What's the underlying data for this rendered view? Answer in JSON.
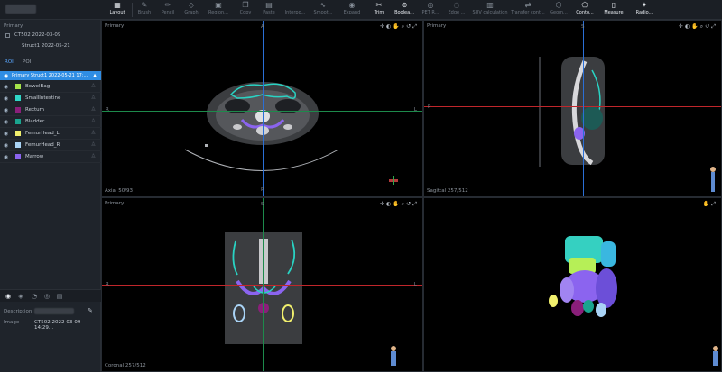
{
  "toolbar": {
    "items": [
      {
        "label": "Layout",
        "icon": "layout-icon"
      },
      {
        "label": "Brush",
        "icon": "brush-icon"
      },
      {
        "label": "Pencil",
        "icon": "pencil-icon"
      },
      {
        "label": "Graph",
        "icon": "graph-icon"
      },
      {
        "label": "Region...",
        "icon": "region-icon"
      },
      {
        "label": "Copy",
        "icon": "copy-icon"
      },
      {
        "label": "Paste",
        "icon": "paste-icon"
      },
      {
        "label": "Interpo...",
        "icon": "interpolate-icon"
      },
      {
        "label": "Smoot...",
        "icon": "smooth-icon"
      },
      {
        "label": "Expand",
        "icon": "expand-icon"
      },
      {
        "label": "Trim",
        "icon": "trim-icon"
      },
      {
        "label": "Boolea...",
        "icon": "boolean-icon"
      },
      {
        "label": "PET R...",
        "icon": "pet-icon"
      },
      {
        "label": "Edge ...",
        "icon": "edge-icon"
      },
      {
        "label": "SUV calculation",
        "icon": "suv-icon"
      },
      {
        "label": "Transfer cont...",
        "icon": "transfer-icon"
      },
      {
        "label": "Geom...",
        "icon": "geometry-icon"
      },
      {
        "label": "Conto...",
        "icon": "contour-icon"
      },
      {
        "label": "Measure",
        "icon": "measure-icon"
      },
      {
        "label": "Radio...",
        "icon": "radiomics-icon"
      }
    ]
  },
  "left": {
    "primary_label": "Primary",
    "tree": [
      {
        "label": "CT502  2022-03-09"
      },
      {
        "label": "Struct1  2022-05-21"
      }
    ],
    "tabs": [
      "ROI",
      "POI"
    ],
    "roi_header": "Primary  Struct1 2022-05-21 17:...",
    "rois": [
      {
        "name": "BowelBag",
        "color": "#a6e34a"
      },
      {
        "name": "SmallIntestine",
        "color": "#2fd6c6"
      },
      {
        "name": "Rectum",
        "color": "#8a1f7a"
      },
      {
        "name": "Bladder",
        "color": "#1aa58f"
      },
      {
        "name": "FemurHead_L",
        "color": "#f0ef6d"
      },
      {
        "name": "FemurHead_R",
        "color": "#a9d3f5"
      },
      {
        "name": "Marrow",
        "color": "#8b64ef"
      }
    ],
    "description_label": "Description",
    "image_label": "Image",
    "image_value": "CT502 2022-03-09 14:29..."
  },
  "viewports": {
    "axial": {
      "name": "Primary",
      "info": "Axial 50/93",
      "top": "A",
      "bottom": "P",
      "left": "R",
      "right": "L"
    },
    "sagittal": {
      "name": "Primary",
      "info": "Sagittal 257/512",
      "top": "S",
      "left": "P"
    },
    "coronal": {
      "name": "Primary",
      "info": "Coronal 257/512",
      "top": "S",
      "left": "R",
      "right": "L"
    },
    "render3d": {
      "name": ""
    }
  },
  "crosshair": {
    "horizontal": "#c0262b",
    "vertical_axial": "#1d8a4b",
    "vertical": "#2a6fd6"
  }
}
